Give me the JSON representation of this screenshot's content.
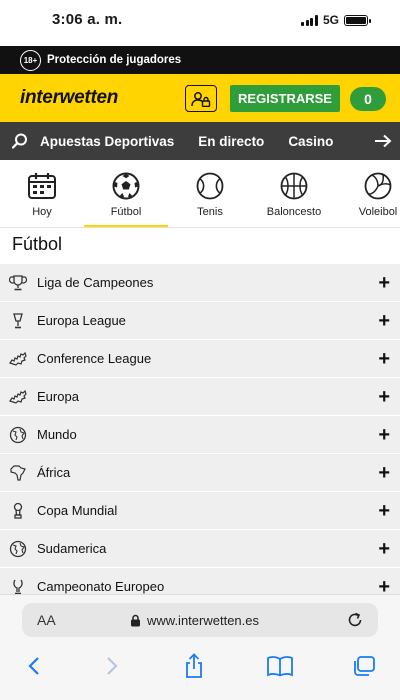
{
  "status": {
    "time": "3:06 a. m.",
    "network": "5G"
  },
  "protection": {
    "badge": "18+",
    "text": "Protección de jugadores"
  },
  "header": {
    "logo": "interwetten",
    "register_label": "REGISTRARSE",
    "count": "0"
  },
  "nav": {
    "items": [
      "Apuestas Deportivas",
      "En directo",
      "Casino"
    ]
  },
  "sports": [
    {
      "label": "Hoy",
      "icon": "calendar-icon",
      "active": false
    },
    {
      "label": "Fútbol",
      "icon": "soccer-ball-icon",
      "active": true
    },
    {
      "label": "Tenis",
      "icon": "tennis-ball-icon",
      "active": false
    },
    {
      "label": "Baloncesto",
      "icon": "basketball-icon",
      "active": false
    },
    {
      "label": "Voleibol",
      "icon": "volleyball-icon",
      "active": false
    }
  ],
  "section_title": "Fútbol",
  "competitions": [
    {
      "label": "Liga de Campeones",
      "icon": "trophy-icon"
    },
    {
      "label": "Europa League",
      "icon": "cup-icon"
    },
    {
      "label": "Conference League",
      "icon": "europe-map-icon"
    },
    {
      "label": "Europa",
      "icon": "europe-map-icon"
    },
    {
      "label": "Mundo",
      "icon": "globe-icon"
    },
    {
      "label": "África",
      "icon": "africa-map-icon"
    },
    {
      "label": "Copa Mundial",
      "icon": "world-cup-trophy-icon"
    },
    {
      "label": "Sudamerica",
      "icon": "globe-icon"
    },
    {
      "label": "Campeonato Europeo",
      "icon": "trophy-icon"
    }
  ],
  "browser": {
    "aa_label": "AA",
    "url": "www.interwetten.es"
  },
  "colors": {
    "brand_yellow": "#ffd400",
    "register_green": "#2f9e3a",
    "nav_gray": "#3d3d3d"
  }
}
